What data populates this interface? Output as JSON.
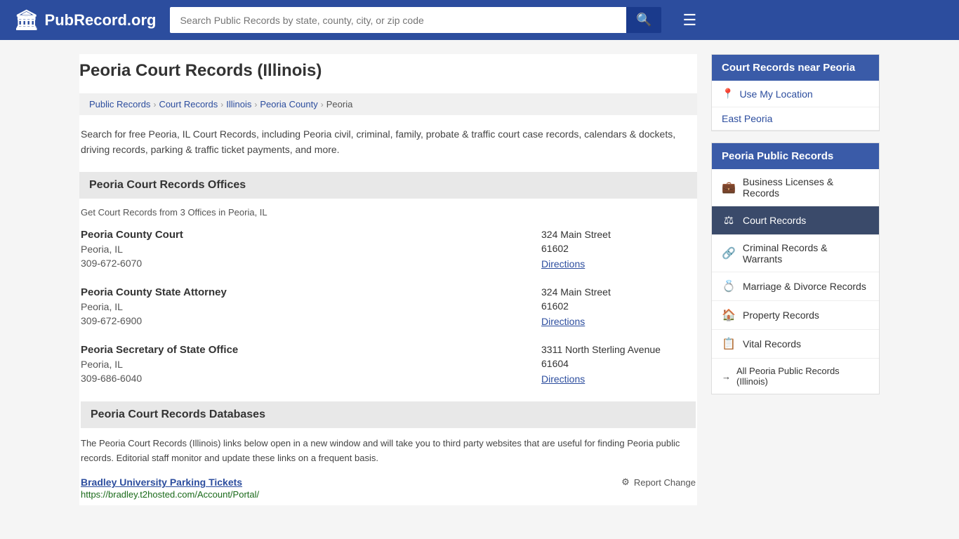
{
  "header": {
    "logo_icon": "🏛",
    "logo_text": "PubRecord.org",
    "search_placeholder": "Search Public Records by state, county, city, or zip code",
    "search_button_icon": "🔍",
    "menu_icon": "☰"
  },
  "page": {
    "title": "Peoria Court Records (Illinois)",
    "description": "Search for free Peoria, IL Court Records, including Peoria civil, criminal, family, probate & traffic court case records, calendars & dockets, driving records, parking & traffic ticket payments, and more."
  },
  "breadcrumb": {
    "items": [
      {
        "label": "Public Records",
        "href": "#"
      },
      {
        "label": "Court Records",
        "href": "#"
      },
      {
        "label": "Illinois",
        "href": "#"
      },
      {
        "label": "Peoria County",
        "href": "#"
      },
      {
        "label": "Peoria",
        "href": "#"
      }
    ]
  },
  "offices_section": {
    "heading": "Peoria Court Records Offices",
    "sub": "Get Court Records from 3 Offices in Peoria, IL",
    "offices": [
      {
        "name": "Peoria County Court",
        "city": "Peoria, IL",
        "phone": "309-672-6070",
        "address": "324 Main Street",
        "zip": "61602",
        "directions_label": "Directions"
      },
      {
        "name": "Peoria County State Attorney",
        "city": "Peoria, IL",
        "phone": "309-672-6900",
        "address": "324 Main Street",
        "zip": "61602",
        "directions_label": "Directions"
      },
      {
        "name": "Peoria Secretary of State Office",
        "city": "Peoria, IL",
        "phone": "309-686-6040",
        "address": "3311 North Sterling Avenue",
        "zip": "61604",
        "directions_label": "Directions"
      }
    ]
  },
  "databases_section": {
    "heading": "Peoria Court Records Databases",
    "description": "The Peoria Court Records (Illinois) links below open in a new window and will take you to third party websites that are useful for finding Peoria public records. Editorial staff monitor and update these links on a frequent basis.",
    "entries": [
      {
        "name": "Bradley University Parking Tickets",
        "url": "https://bradley.t2hosted.com/Account/Portal/",
        "report_change_label": "Report Change",
        "report_icon": "⚙"
      }
    ]
  },
  "sidebar": {
    "nearby_header": "Court Records near Peoria",
    "use_location_label": "Use My Location",
    "location_icon": "📍",
    "nearby_city": "East Peoria",
    "public_records_header": "Peoria Public Records",
    "items": [
      {
        "label": "Business Licenses & Records",
        "icon": "💼",
        "active": false
      },
      {
        "label": "Court Records",
        "icon": "⚖",
        "active": true
      },
      {
        "label": "Criminal Records & Warrants",
        "icon": "🔗",
        "active": false
      },
      {
        "label": "Marriage & Divorce Records",
        "icon": "💍",
        "active": false
      },
      {
        "label": "Property Records",
        "icon": "🏠",
        "active": false
      },
      {
        "label": "Vital Records",
        "icon": "📋",
        "active": false
      }
    ],
    "all_records_label": "All Peoria Public Records (Illinois)",
    "all_records_icon": "→"
  }
}
